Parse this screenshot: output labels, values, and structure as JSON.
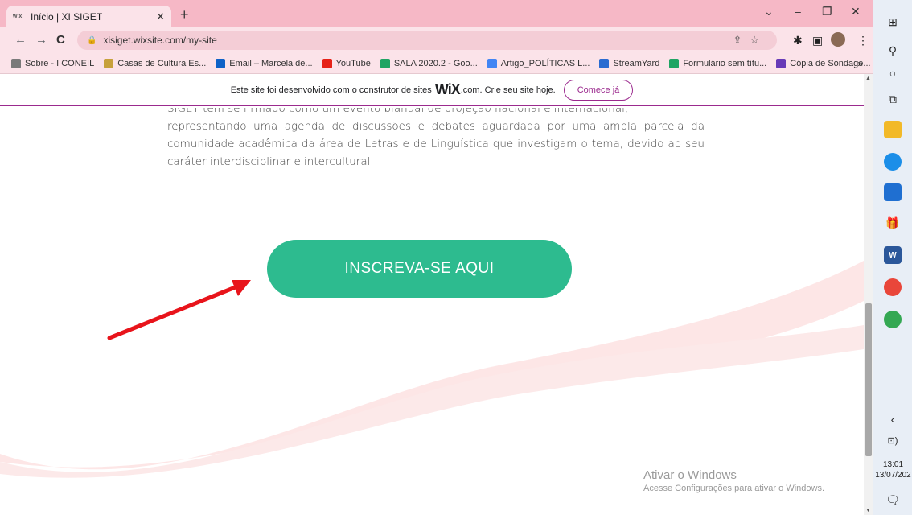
{
  "browser": {
    "tab": {
      "favicon": "wix",
      "title": "Início | XI SIGET"
    },
    "url": "xisiget.wixsite.com/my-site",
    "bookmarks": [
      {
        "label": "Sobre - I CONEIL",
        "color": "#7a7a7a"
      },
      {
        "label": "Casas de Cultura Es...",
        "color": "#c7a13b"
      },
      {
        "label": "Email – Marcela de...",
        "color": "#0f62c7"
      },
      {
        "label": "YouTube",
        "color": "#e62117"
      },
      {
        "label": "SALA 2020.2 - Goo...",
        "color": "#1fa463"
      },
      {
        "label": "Artigo_POLÍTICAS L...",
        "color": "#4285f4"
      },
      {
        "label": "StreamYard",
        "color": "#2a6bd1"
      },
      {
        "label": "Formulário sem títu...",
        "color": "#1fa463"
      },
      {
        "label": "Cópia de Sondage...",
        "color": "#673ab7"
      }
    ],
    "bookmarks_more": "»"
  },
  "wix_banner": {
    "text_before": "Este site foi desenvolvido com o construtor de sites",
    "brand": "WiX",
    "text_after": ".com. Crie seu site hoje.",
    "button": "Comece já"
  },
  "page": {
    "clipped_line": "SIGET tem se firmado como um evento bianual de projeção nacional e internacional,",
    "paragraph": "representando uma agenda de discussões e debates aguardada por uma ampla parcela da comunidade acadêmica da área de Letras e de Linguística que investigam o tema, devido ao seu caráter interdisciplinar e intercultural.",
    "cta_label": "INSCREVA-SE AQUI",
    "cta_color": "#2dbb8f",
    "arrow_color": "#e8141b"
  },
  "watermark": {
    "title": "Ativar o Windows",
    "subtitle": "Acesse Configurações para ativar o Windows."
  },
  "taskbar": {
    "time": "13:01",
    "date": "13/07/202"
  }
}
